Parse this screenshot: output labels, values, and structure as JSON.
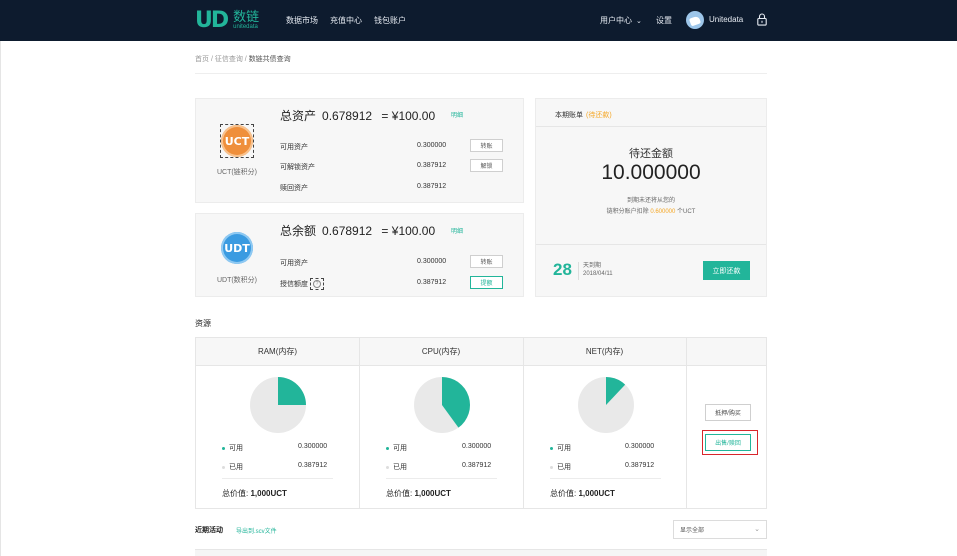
{
  "nav": {
    "logo_cn": "数链",
    "logo_en": "unitedata",
    "items": [
      "数据市场",
      "充值中心",
      "钱包账户"
    ],
    "user_center": "用户中心",
    "settings": "设置",
    "username": "Unitedata"
  },
  "breadcrumb": [
    "首页",
    "征信查询",
    "数链共债查询"
  ],
  "uct_card": {
    "coin": "UCT",
    "coin_label": "UCT(链积分)",
    "title_label": "总资产",
    "amount": "0.678912",
    "equals": "= ¥100.00",
    "detail_link": "明细",
    "rows": [
      {
        "label": "可用资产",
        "value": "0.300000",
        "button": "转账"
      },
      {
        "label": "可解锁资产",
        "value": "0.387912",
        "button": "解锁"
      },
      {
        "label": "赎回资产",
        "value": "0.387912",
        "button": ""
      }
    ]
  },
  "udt_card": {
    "coin": "UDT",
    "coin_label": "UDT(数积分)",
    "title_label": "总余额",
    "amount": "0.678912",
    "equals": "= ¥100.00",
    "detail_link": "明细",
    "rows": [
      {
        "label": "可用资产",
        "value": "0.300000",
        "button": "转账"
      },
      {
        "label": "授信额度",
        "value": "0.387912",
        "button": "提额"
      }
    ]
  },
  "bill": {
    "title": "本期账单",
    "status": "(待还款)",
    "caption": "待还金额",
    "amount": "10.000000",
    "note_line1": "到期未还将从您的",
    "note_prefix": "链积分账户扣除",
    "note_amount": "0.600000",
    "note_suffix": "个UCT",
    "days": "28",
    "days_label": "天到期",
    "due_date": "2018/04/11",
    "repay_button": "立即还款"
  },
  "resources": {
    "section_title": "资源",
    "columns": [
      {
        "name": "RAM(内存)",
        "used_fraction": 0.25,
        "available_label": "可用",
        "available": "0.300000",
        "used_label": "已用",
        "used": "0.387912",
        "total_label": "总价值:",
        "total": "1,000UCT"
      },
      {
        "name": "CPU(内存)",
        "used_fraction": 0.4,
        "available_label": "可用",
        "available": "0.300000",
        "used_label": "已用",
        "used": "0.387912",
        "total_label": "总价值:",
        "total": "1,000UCT"
      },
      {
        "name": "NET(内存)",
        "used_fraction": 0.12,
        "available_label": "可用",
        "available": "0.300000",
        "used_label": "已用",
        "used": "0.387912",
        "total_label": "总价值:",
        "total": "1,000UCT"
      }
    ],
    "buy_button": "抵押/购买",
    "sell_button": "出售/赎回"
  },
  "recent": {
    "title": "近期活动",
    "export_link": "导出到.scv文件",
    "filter": "显示全部"
  },
  "colors": {
    "accent": "#22b59a",
    "nav_bg": "#0d1b2e",
    "pending": "#f5a623",
    "highlight": "#d9262c"
  }
}
